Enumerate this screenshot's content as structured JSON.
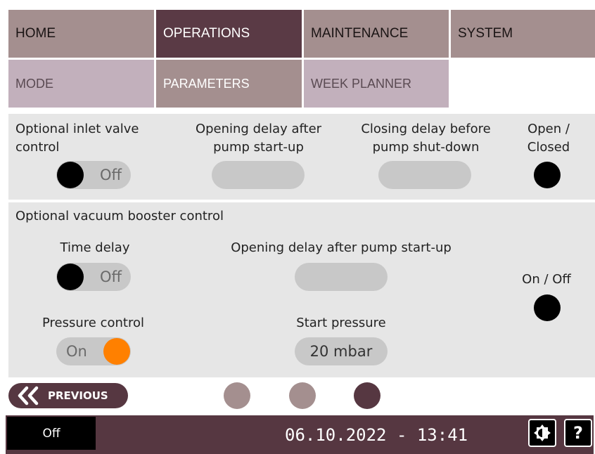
{
  "nav": {
    "primary": [
      {
        "label": "HOME",
        "active": false
      },
      {
        "label": "OPERATIONS",
        "active": true
      },
      {
        "label": "MAINTENANCE",
        "active": false
      },
      {
        "label": "SYSTEM",
        "active": false
      }
    ],
    "secondary": [
      {
        "label": "MODE",
        "active": false
      },
      {
        "label": "PARAMETERS",
        "active": true
      },
      {
        "label": "WEEK PLANNER",
        "active": false
      }
    ]
  },
  "inlet": {
    "control_label": "Optional inlet valve\ncontrol",
    "toggle_state": "Off",
    "opening_delay_label": "Opening delay after\npump start-up",
    "opening_delay_value": "",
    "closing_delay_label": "Closing delay before\npump shut-down",
    "closing_delay_value": "",
    "open_closed_label": "Open /\nClosed"
  },
  "booster": {
    "section_label": "Optional vacuum booster control",
    "time_delay_label": "Time delay",
    "time_delay_state": "Off",
    "opening_delay_label": "Opening delay after pump start-up",
    "opening_delay_value": "",
    "on_off_label": "On / Off",
    "pressure_control_label": "Pressure control",
    "pressure_control_state": "On",
    "start_pressure_label": "Start pressure",
    "start_pressure_value": "20 mbar"
  },
  "pager": {
    "previous_label": "PREVIOUS",
    "current_page": 3,
    "total_pages": 3
  },
  "footer": {
    "status": "Off",
    "datetime": "06.10.2022 - 13:41"
  },
  "colors": {
    "brand_dark": "#563741",
    "accent_on": "#ff8000",
    "indicator_off": "#000000"
  }
}
